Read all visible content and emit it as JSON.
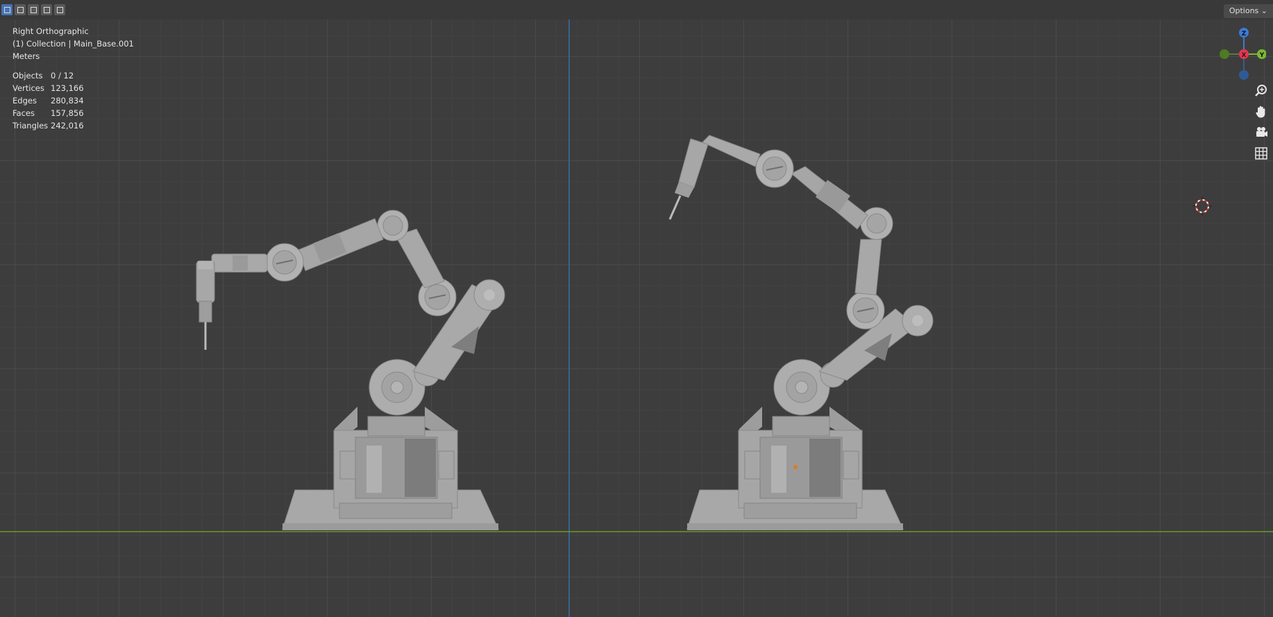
{
  "viewport": {
    "view_name": "Right Orthographic",
    "collection_line": "(1) Collection | Main_Base.001",
    "units": "Meters",
    "stats": [
      {
        "label": "Objects",
        "value": "0 / 12"
      },
      {
        "label": "Vertices",
        "value": "123,166"
      },
      {
        "label": "Edges",
        "value": "280,834"
      },
      {
        "label": "Faces",
        "value": "157,856"
      },
      {
        "label": "Triangles",
        "value": "242,016"
      }
    ],
    "options_label": "Options",
    "gizmo": {
      "z": "Z",
      "x": "X",
      "y": "Y"
    }
  },
  "header": {
    "mode_buttons": [
      "select-box-icon",
      "extend-selection-icon",
      "subtract-selection-icon",
      "invert-selection-icon",
      "intersect-selection-icon"
    ]
  },
  "nav_tools": [
    "zoom-icon",
    "pan-hand-icon",
    "camera-icon",
    "grid-toggle-icon"
  ],
  "colors": {
    "background": "#3d3d3d",
    "grid_minor": "#474747",
    "grid_major": "#505050",
    "axis_vertical": "#3a6ea5",
    "axis_horizontal": "#6a9a2c",
    "robot": "#a5a5a5"
  }
}
